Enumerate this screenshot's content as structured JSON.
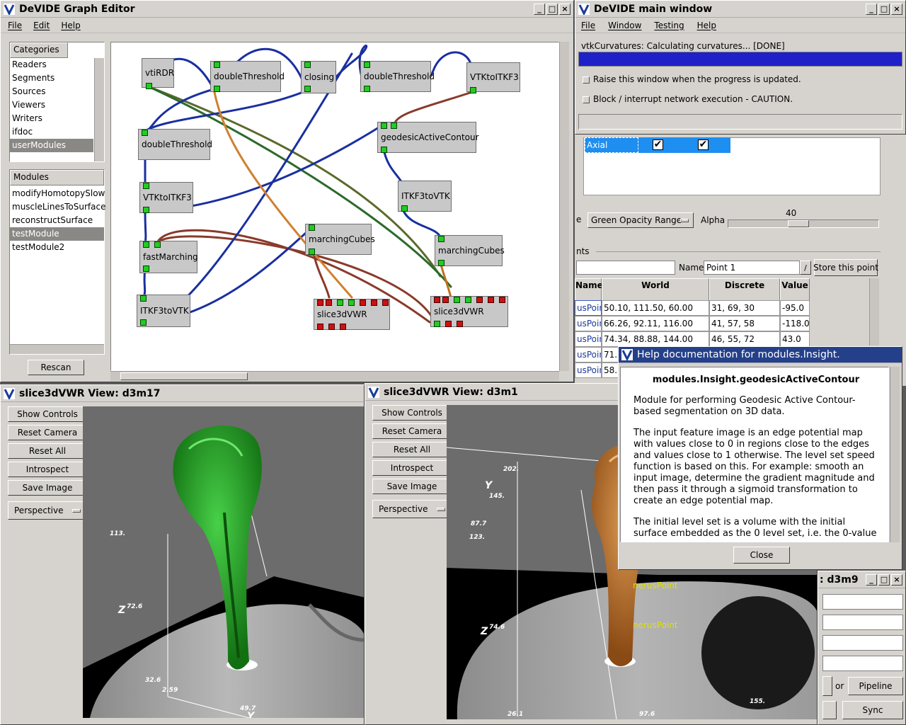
{
  "graph_editor": {
    "title": "DeVIDE Graph Editor",
    "menu": [
      "File",
      "Edit",
      "Help"
    ],
    "categories_header": "Categories",
    "categories": [
      "Readers",
      "Segments",
      "Sources",
      "Viewers",
      "Writers",
      "ifdoc",
      "userModules"
    ],
    "selected_category": "userModules",
    "modules_header": "Modules",
    "modules": [
      "modifyHomotopySlow",
      "muscleLinesToSurface",
      "reconstructSurface",
      "testModule",
      "testModule2"
    ],
    "selected_module": "testModule",
    "rescan": "Rescan",
    "nodes": {
      "vtiRDR": "vtiRDR",
      "dt1": "doubleThreshold",
      "closing": "closing",
      "dt2": "doubleThreshold",
      "vtk2itk1": "VTKtoITKF3",
      "dt3": "doubleThreshold",
      "gac": "geodesicActiveContour",
      "vtk2itk2": "VTKtoITKF3",
      "itk2vtk1": "ITKF3toVTK",
      "fm": "fastMarching",
      "mc1": "marchingCubes",
      "mc2": "marchingCubes",
      "itk2vtk2": "ITKF3toVTK",
      "sv1": "slice3dVWR",
      "sv2": "slice3dVWR"
    }
  },
  "main_window": {
    "title": "DeVIDE main window",
    "menu": [
      "File",
      "Window",
      "Testing",
      "Help"
    ],
    "progress_text": "vtkCurvatures: Calculating curvatures... [DONE]",
    "progress": 1.0,
    "raise_label": "Raise this window when the progress is updated.",
    "block_label": "Block / interrupt network execution - CAUTION."
  },
  "slice_panel": {
    "axial": "Axial",
    "mode_label_fragment": "e",
    "opacity_option": "Green Opacity Range",
    "alpha_label": "Alpha",
    "alpha_value": "40",
    "points_label_fragment": "nts",
    "name_label": "Name",
    "name_value": "Point 1",
    "store_button": "Store this point",
    "table_headers": [
      "Name",
      "World",
      "Discrete",
      "Value"
    ],
    "rows": [
      [
        "usPoin",
        "50.10, 111.50, 60.00",
        "31, 69, 30",
        "-95.0"
      ],
      [
        "usPoint",
        "66.26, 92.11, 116.00",
        "41, 57, 58",
        "-118.0"
      ],
      [
        "usPoint",
        "74.34, 88.88, 144.00",
        "46, 55, 72",
        "43.0"
      ],
      [
        "usPoint",
        "71.",
        "",
        " "
      ],
      [
        "usPoint",
        "58.",
        "",
        ""
      ]
    ]
  },
  "help": {
    "title": "Help documentation for modules.Insight.",
    "heading": "modules.Insight.geodesicActiveContour",
    "paragraphs": [
      "Module for performing Geodesic Active Contour-based segmentation on 3D data.",
      "The input feature image is an edge potential map with values close to 0 in regions close to the edges and values close to 1 otherwise. The level set speed function is based on this. For example: smooth an input image, determine the gradient magnitude and then pass it through a sigmoid transformation to create an edge potential map.",
      "The initial level set is a volume with the initial surface embedded as the 0 level set, i.e. the 0-value"
    ],
    "close": "Close"
  },
  "viewer1": {
    "title": "slice3dVWR View: d3m17",
    "buttons": [
      "Show Controls",
      "Reset Camera",
      "Reset All",
      "Introspect",
      "Save Image"
    ],
    "perspective": "Perspective",
    "axis": {
      "z": "Z",
      "v1": "113.",
      "v2": "72.6",
      "v3": "32.6",
      "v4": "2.59",
      "v5": "49.7",
      "y": "Y"
    },
    "surface_color": "#22b422"
  },
  "viewer2": {
    "title": "slice3dVWR View: d3m1",
    "buttons": [
      "Show Controls",
      "Reset Camera",
      "Reset All",
      "Introspect",
      "Save Image"
    ],
    "perspective": "Perspective",
    "axis": {
      "y": "Y",
      "v1": "202.",
      "v2": "145.",
      "v3": "87.7",
      "v4": "123.",
      "z": "Z",
      "v5": "74.6",
      "v6": "26.1",
      "v7": "97.6",
      "v8": "155."
    },
    "labels": [
      "Po",
      "rusPoint",
      "nerusPoint",
      "nerusPoint"
    ],
    "surface_color": "#c8782a"
  },
  "viewer3": {
    "title_fragment": ": d3m9",
    "or_label": "or",
    "pipeline": "Pipeline",
    "sync": "Sync"
  }
}
